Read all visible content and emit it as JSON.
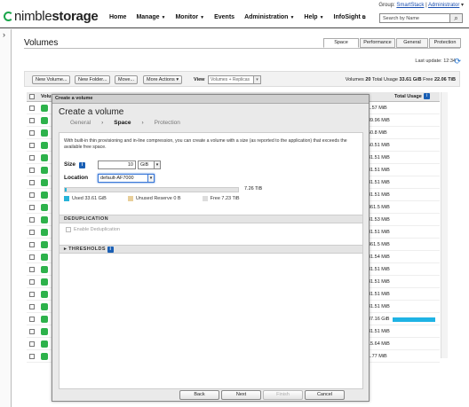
{
  "app": {
    "logo_prefix": "nimble",
    "logo_suffix": "storage",
    "group_line": {
      "prefix": "Group: ",
      "group": "SmartStack",
      "sep": " | ",
      "user": "Administrator",
      "suffix": " ▾"
    },
    "nav": [
      "Home",
      "Manage",
      "Monitor",
      "Events",
      "Administration",
      "Help",
      "InfoSight"
    ],
    "search_placeholder": "Search by Name"
  },
  "page": {
    "title": "Volumes",
    "tabs": [
      "Space",
      "Performance",
      "General",
      "Protection"
    ],
    "active_tab": "Space",
    "last_update": "Last update: 12:34"
  },
  "toolbar": {
    "new_volume": "New Volume...",
    "new_folder": "New Folder...",
    "move": "Move...",
    "more_actions": "More Actions",
    "view_label": "View",
    "view_value": "Volumes + Replicas",
    "summary": {
      "volumes_label": "Volumes",
      "volumes": "20",
      "used_label": "Total Usage",
      "used": "33.61 GiB",
      "free_label": "Free",
      "free": "22.06 TiB"
    }
  },
  "table": {
    "col_volume": "Volu",
    "col_total_usage": "Total Usage",
    "rows": [
      {
        "usage": "1.57 MiB"
      },
      {
        "usage": "39.96 MiB"
      },
      {
        "usage": "50.8 MiB"
      },
      {
        "usage": "50.51 MiB"
      },
      {
        "usage": "31.51 MiB"
      },
      {
        "usage": "31.51 MiB"
      },
      {
        "usage": "31.51 MiB"
      },
      {
        "usage": "31.51 MiB"
      },
      {
        "usage": "361.5 MiB"
      },
      {
        "usage": "31.53 MiB"
      },
      {
        "usage": "31.51 MiB"
      },
      {
        "usage": "361.5 MiB"
      },
      {
        "usage": "31.54 MiB"
      },
      {
        "usage": "31.51 MiB"
      },
      {
        "usage": "31.51 MiB"
      },
      {
        "usage": "31.51 MiB"
      },
      {
        "usage": "31.51 MiB"
      },
      {
        "usage": "37.16 GiB",
        "bar_fraction": 1.0
      },
      {
        "usage": "31.51 MiB"
      },
      {
        "usage": "15.64 MiB"
      },
      {
        "usage": "1.77 MiB"
      }
    ]
  },
  "dialog": {
    "titlebar": "Create a volume",
    "heading": "Create a volume",
    "steps": [
      "General",
      "Space",
      "Protection"
    ],
    "current_step": "Space",
    "description": "With built-in thin provisioning and in-line compression, you can create a volume with a size (as reported to the application) that exceeds the available free space.",
    "size_label": "Size",
    "size_value": "10",
    "size_unit": "GiB",
    "location_label": "Location",
    "location_value": "default-AF7000",
    "capacity_total": "7.26 TiB",
    "legend": [
      {
        "label": "Used 33.61 GiB",
        "color": "#27b3d8"
      },
      {
        "label": "Unused Reserve 0 B",
        "color": "#e8cf9a"
      },
      {
        "label": "Free 7.23 TiB",
        "color": "#dddddd"
      }
    ],
    "dedup_header": "DEDUPLICATION",
    "dedup_option": "Enable Deduplication",
    "thresholds_header": "THRESHOLDS",
    "buttons": {
      "back": "Back",
      "next": "Next",
      "finish": "Finish",
      "cancel": "Cancel"
    }
  }
}
